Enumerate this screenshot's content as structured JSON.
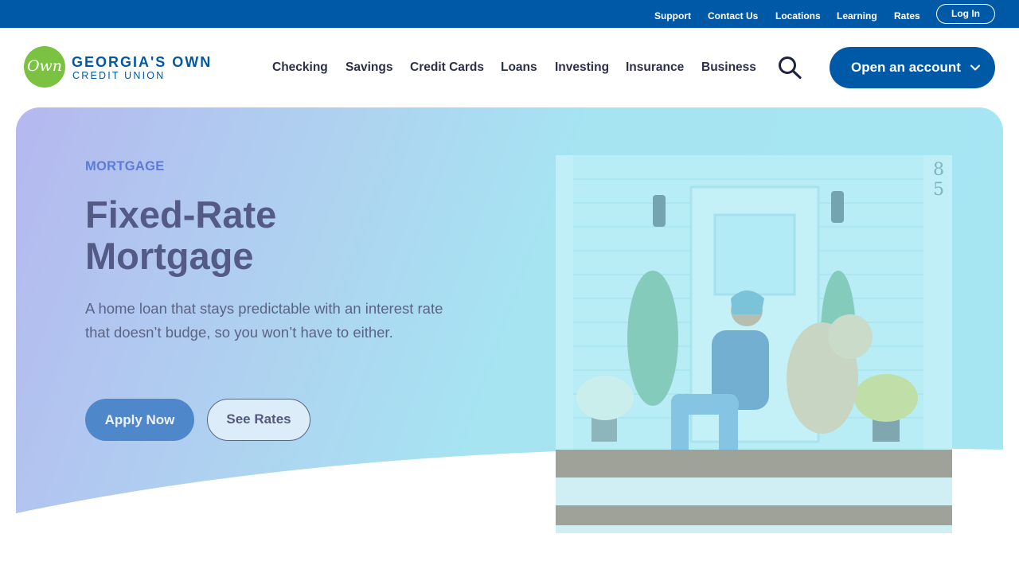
{
  "utility_nav": {
    "links": [
      {
        "label": "Support"
      },
      {
        "label": "Contact Us"
      },
      {
        "label": "Locations"
      },
      {
        "label": "Learning"
      },
      {
        "label": "Rates"
      }
    ],
    "login_label": "Log In"
  },
  "brand": {
    "logo_script": "Own",
    "name": "GEORGIA'S OWN",
    "sub": "CREDIT UNION"
  },
  "main_nav": {
    "items": [
      {
        "label": "Checking"
      },
      {
        "label": "Savings"
      },
      {
        "label": "Credit Cards"
      },
      {
        "label": "Loans"
      },
      {
        "label": "Investing"
      },
      {
        "label": "Insurance"
      },
      {
        "label": "Business"
      }
    ],
    "search_icon": "search-icon",
    "cta_label": "Open an account",
    "cta_icon": "chevron-down-icon"
  },
  "hero": {
    "eyebrow": "MORTGAGE",
    "title": "Fixed-Rate Mortgage",
    "description": "A home loan that stays predictable with an interest rate that doesn’t budge, so you won’t have to either.",
    "primary_button": "Apply Now",
    "secondary_button": "See Rates",
    "house_number": "85"
  },
  "colors": {
    "brand_blue": "#0059a6",
    "logo_green": "#7cc242",
    "hero_gradient_start": "#b5b8ef",
    "hero_gradient_end": "#a6e6f3",
    "apply_button": "#4f87cb"
  }
}
